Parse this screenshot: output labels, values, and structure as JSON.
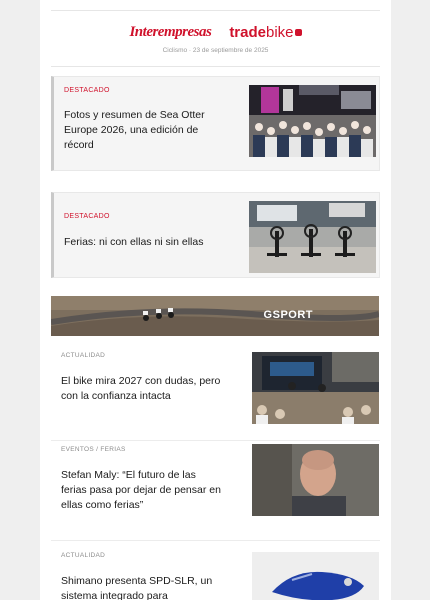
{
  "header": {
    "logo_interempresas": "Interempresas",
    "logo_trade": "trade",
    "logo_bike": "bike",
    "meta": "Ciclismo · 23 de septiembre de 2025"
  },
  "featured": [
    {
      "tag": "DESTACADO",
      "headline": "Fotos y resumen de Sea Otter Europe 2026, una edición de récord",
      "image": "expo-crowd-photo"
    },
    {
      "tag": "DESTACADO",
      "headline": "Ferias: ni con ellas ni sin ellas",
      "image": "trade-fair-stand-photo"
    }
  ],
  "banner": {
    "label": "GSPORT",
    "image": "cyclists-road-banner"
  },
  "items": [
    {
      "tag": "ACTUALIDAD",
      "headline": "El bike mira 2027 con dudas, pero con la confianza intacta",
      "image": "conference-panel-photo"
    },
    {
      "tag": "EVENTOS / FERIAS",
      "headline": "Stefan Maly: “El futuro de las ferias pasa por dejar de pensar en ellas como ferias”",
      "image": "portrait-photo"
    },
    {
      "tag": "ACTUALIDAD",
      "headline": "Shimano presenta SPD-SLR, un sistema integrado para",
      "image": "cycling-shoe-photo"
    }
  ],
  "colors": {
    "brand_red": "#d0122c",
    "tag_grey": "#8c8c8c",
    "text": "#1b1b1b"
  }
}
